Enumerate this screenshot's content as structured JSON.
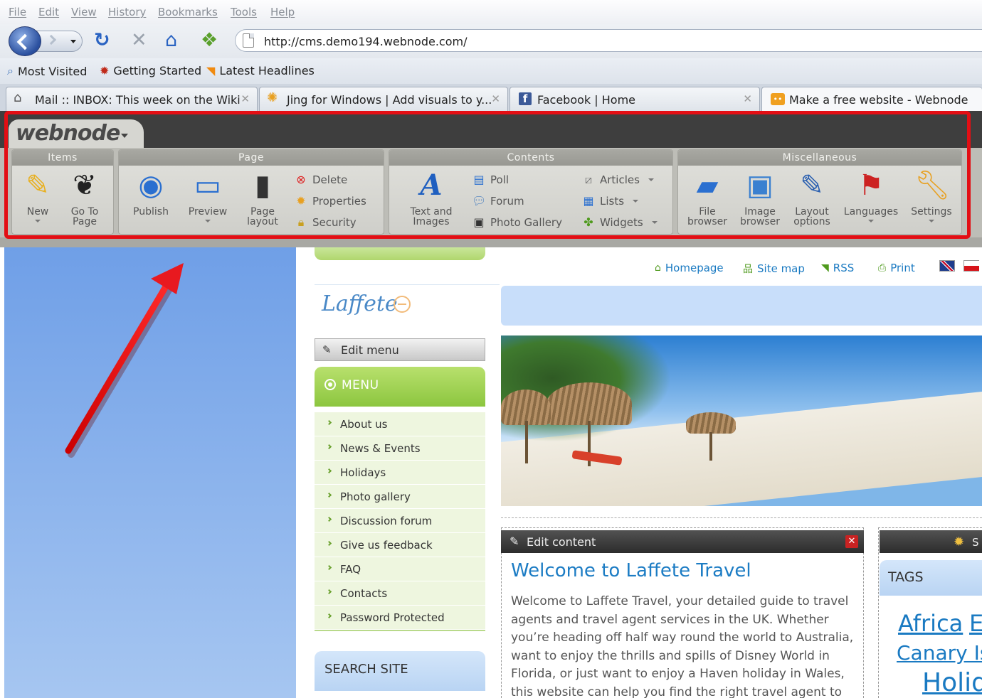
{
  "browser": {
    "menu": [
      "File",
      "Edit",
      "View",
      "History",
      "Bookmarks",
      "Tools",
      "Help"
    ],
    "url": "http://cms.demo194.webnode.com/",
    "icons": {
      "back": "back-arrow-icon",
      "forward": "forward-arrow-icon",
      "reload": "reload-icon",
      "stop": "stop-icon",
      "home": "home-icon",
      "addon": "addon-icon",
      "page": "page-icon"
    },
    "bookmarks": [
      {
        "label": "Most Visited",
        "icon": "magnifier-icon"
      },
      {
        "label": "Getting Started",
        "icon": "firefox-icon"
      },
      {
        "label": "Latest Headlines",
        "icon": "rss-icon"
      }
    ],
    "tabs": [
      {
        "label": "Mail :: INBOX: This week on the Wiki",
        "icon": "home-icon"
      },
      {
        "label": "Jing for Windows | Add visuals to y...",
        "icon": "jing-icon"
      },
      {
        "label": "Facebook | Home",
        "icon": "facebook-icon"
      },
      {
        "label": "Make a free website - Webnode",
        "icon": "webnode-icon"
      }
    ]
  },
  "toolbar": {
    "logo": "webnode",
    "groups": {
      "items": "Items",
      "page": "Page",
      "contents": "Contents",
      "misc": "Miscellaneous"
    },
    "items": {
      "new": "New",
      "goto_1": "Go To",
      "goto_2": "Page"
    },
    "page": {
      "publish": "Publish",
      "preview": "Preview",
      "layout_1": "Page",
      "layout_2": "layout",
      "delete": "Delete",
      "properties": "Properties",
      "security": "Security"
    },
    "contents": {
      "text_1": "Text and",
      "text_2": "Images",
      "poll": "Poll",
      "forum": "Forum",
      "gallery": "Photo Gallery",
      "articles": "Articles",
      "lists": "Lists",
      "widgets": "Widgets"
    },
    "misc": {
      "file_1": "File",
      "file_2": "browser",
      "image_1": "Image",
      "image_2": "browser",
      "layout_1": "Layout",
      "layout_2": "options",
      "languages": "Languages",
      "settings": "Settings"
    }
  },
  "site": {
    "top_links": [
      "Homepage",
      "Site map",
      "RSS",
      "Print"
    ],
    "logo": "Laffete",
    "edit_menu": "Edit menu",
    "menu_title": "MENU",
    "menu_items": [
      "About us",
      "News & Events",
      "Holidays",
      "Photo gallery",
      "Discussion forum",
      "Give us feedback",
      "FAQ",
      "Contacts",
      "Password Protected"
    ],
    "search_title": "SEARCH SITE",
    "edit_content": "Edit content",
    "close": "✕",
    "welcome_title": "Welcome to Laffete Travel",
    "welcome_text": "Welcome to Laffete Travel, your detailed guide to travel agents and travel agent services in the UK. Whether you’re heading off half way round the world to Australia, want to enjoy the thrills and spills of Disney World in Florida, or just want to enjoy a Haven holiday in Wales, this website can help you find the right travel agent to book your dream",
    "tags_bar_text": "S",
    "tags_title": "TAGS",
    "tags": [
      "Africa",
      "E",
      "Canary Is",
      "Holid"
    ]
  },
  "colors": {
    "highlight": "#e30e14",
    "link": "#1a7ac2",
    "menu_green": "#8cc63f"
  }
}
